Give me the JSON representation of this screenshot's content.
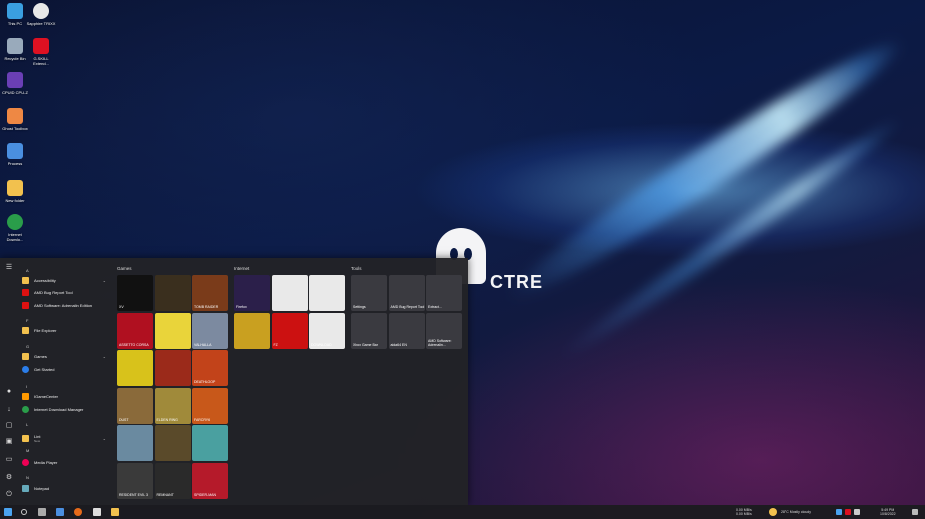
{
  "wallpaper": {
    "logo_text": "CTRE"
  },
  "desktop": {
    "icons": [
      {
        "label": "This PC",
        "color": "#3a9fe0"
      },
      {
        "label": "Sapphire TRIXX",
        "color": "#e8e8e8"
      },
      {
        "label": "Recycle Bin",
        "color": "#9ab"
      },
      {
        "label": "G.SKILL Extend...",
        "color": "#d12"
      },
      {
        "label": "CPUID CPU-Z",
        "color": "#6a3fb5"
      },
      {
        "label": "Ghost Toolbox",
        "color": "#e84"
      },
      {
        "label": "Process",
        "color": "#4a8fe0"
      },
      {
        "label": "New folder",
        "color": "#f2c14e"
      },
      {
        "label": "Internet Downlo...",
        "color": "#2a9d4a"
      }
    ]
  },
  "start_menu": {
    "letters": {
      "a": "A",
      "e": "E",
      "f": "F",
      "g": "G",
      "i": "I",
      "l": "L",
      "m": "M",
      "n": "N"
    },
    "apps": [
      {
        "label": "Accessibility",
        "color": "#f2c14e",
        "expandable": true
      },
      {
        "label": "AMD Bug Report Tool",
        "color": "#d11"
      },
      {
        "label": "AMD Software: Adrenalin Edition",
        "color": "#d11"
      },
      {
        "label": "File Explorer",
        "color": "#f2c14e"
      },
      {
        "label": "Games",
        "color": "#f2c14e",
        "expandable": true
      },
      {
        "label": "Get Started",
        "color": "#2b7de9"
      },
      {
        "label": "IGameCenter",
        "color": "#f90"
      },
      {
        "label": "Internet Download Manager",
        "color": "#2a9d4a"
      },
      {
        "label": "Lint",
        "sub": "New",
        "color": "#f2c14e",
        "expandable": true
      },
      {
        "label": "Media Player",
        "color": "#e05"
      },
      {
        "label": "Notepad",
        "color": "#6ab"
      }
    ],
    "groups": {
      "games": "Games",
      "internet": "Internet",
      "tools": "Tools"
    },
    "game_tiles": [
      {
        "label": "XV",
        "color": "#111"
      },
      {
        "label": "",
        "color": "#3a2f1e"
      },
      {
        "label": "TOMB RAIDER",
        "color": "#7a3b1a"
      },
      {
        "label": "ASSETTO CORSA",
        "color": "#b01020"
      },
      {
        "label": "",
        "color": "#e9d43a"
      },
      {
        "label": "VALHALLA",
        "color": "#7c8aa0"
      },
      {
        "label": "",
        "color": "#d8c21b"
      },
      {
        "label": "",
        "color": "#9b2a1a"
      },
      {
        "label": "DEATHLOOP",
        "color": "#c2431a"
      },
      {
        "label": "DUST",
        "color": "#8a6a3a"
      },
      {
        "label": "ELDEN RING",
        "color": "#a08a3a"
      },
      {
        "label": "FARCRY6",
        "color": "#c8581a"
      },
      {
        "label": "",
        "color": "#6a8aa0"
      },
      {
        "label": "",
        "color": "#5a4a2a"
      },
      {
        "label": "",
        "color": "#4aa0a0"
      },
      {
        "label": "RESIDENT EVIL 3",
        "color": "#3a3a3a"
      },
      {
        "label": "REMNANT",
        "color": "#2a2a2a"
      },
      {
        "label": "SPIDER-MAN",
        "color": "#b51a2a"
      }
    ],
    "internet_tiles": [
      {
        "label": "Firefox",
        "color": "#2b1f4a"
      },
      {
        "label": "",
        "color": "#e9e9e9"
      },
      {
        "label": "",
        "color": "#e9e9e9"
      },
      {
        "label": "",
        "color": "#c9a020"
      },
      {
        "label": "FZ",
        "color": "#c11"
      },
      {
        "label": "DOWNLOAD",
        "color": "#e9e9e9"
      }
    ],
    "tool_tiles": [
      {
        "label": "Settings",
        "color": "#3a3a40"
      },
      {
        "label": "AMD Bug Report Tool",
        "color": "#3a3a40"
      },
      {
        "label": "Extract...",
        "color": "#3a3a40"
      },
      {
        "label": "Xbox Game Bar",
        "color": "#3a3a40"
      },
      {
        "label": "aida64 EN",
        "color": "#3a3a40"
      },
      {
        "label": "AMD Software: Adrenalin...",
        "color": "#3a3a40"
      }
    ]
  },
  "taskbar": {
    "net_top": "0.00 MB/s",
    "net_bottom": "0.00 MB/s",
    "weather": "28°C  Mostly cloudy",
    "time": "5:49 PM",
    "date": "10/8/2022"
  }
}
